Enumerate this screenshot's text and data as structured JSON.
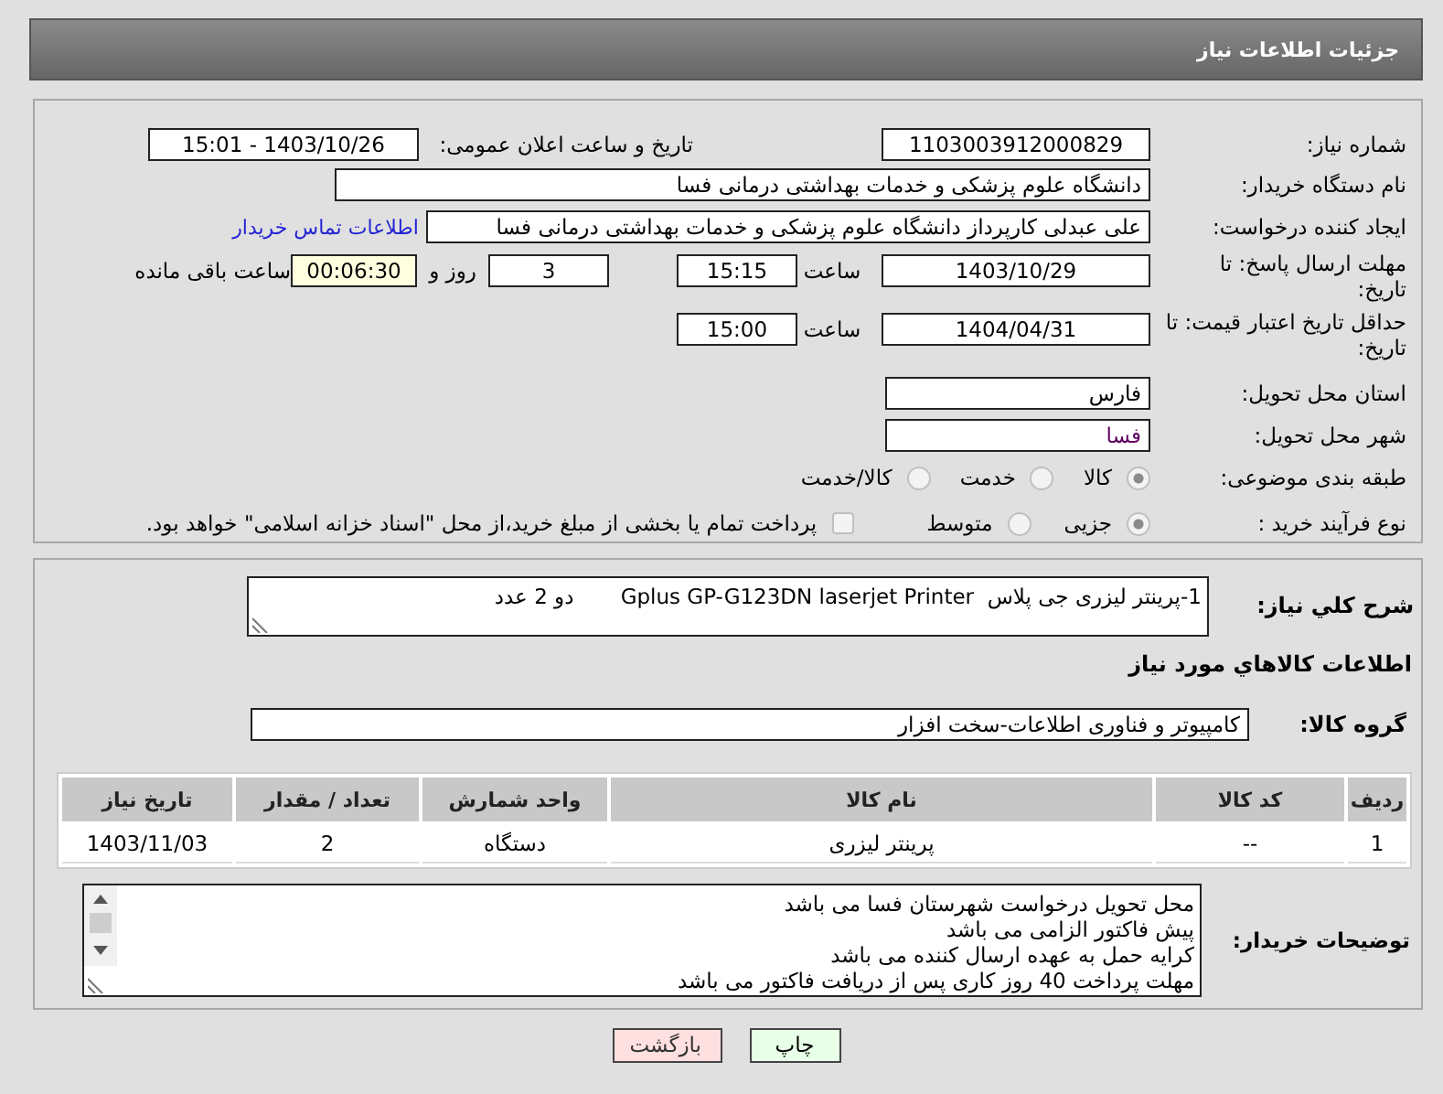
{
  "header": {
    "title": "جزئیات اطلاعات نیاز"
  },
  "details": {
    "need_number": {
      "label": "شماره نیاز:",
      "value": "1103003912000829"
    },
    "announce": {
      "label": "تاریخ و ساعت اعلان عمومی:",
      "value": "1403/10/26 - 15:01"
    },
    "buyer_org": {
      "label": "نام دستگاه خریدار:",
      "value": "دانشگاه علوم پزشکی و خدمات بهداشتی درمانی فسا"
    },
    "requester": {
      "label": "ایجاد کننده درخواست:",
      "value": "علی عبدلی کارپرداز دانشگاه علوم پزشکی و خدمات بهداشتی درمانی فسا",
      "contact_link": "اطلاعات تماس خریدار"
    },
    "reply_deadline": {
      "label": "مهلت ارسال پاسخ: تا تاریخ:",
      "date": "1403/10/29",
      "time_label": "ساعت",
      "time": "15:15",
      "days": "3",
      "days_label": "روز و",
      "remaining": "00:06:30",
      "remaining_label": "ساعت باقی مانده"
    },
    "price_validity": {
      "label": "حداقل تاریخ اعتبار قیمت: تا تاریخ:",
      "date": "1404/04/31",
      "time_label": "ساعت",
      "time": "15:00"
    },
    "province": {
      "label": "استان محل تحویل:",
      "value": "فارس"
    },
    "city": {
      "label": "شهر محل تحویل:",
      "value": "فسا"
    },
    "category": {
      "label": "طبقه بندی موضوعی:",
      "options": [
        {
          "label": "کالا",
          "selected": true
        },
        {
          "label": "خدمت",
          "selected": false
        },
        {
          "label": "کالا/خدمت",
          "selected": false
        }
      ]
    },
    "process": {
      "label": "نوع فرآیند خرید :",
      "options": [
        {
          "label": "جزیی",
          "selected": true
        },
        {
          "label": "متوسط",
          "selected": false
        }
      ],
      "treasury": {
        "checked": false,
        "text": "پرداخت تمام یا بخشی از مبلغ خرید،از محل \"اسناد خزانه اسلامی\" خواهد بود."
      }
    }
  },
  "needs": {
    "summary": {
      "label": "شرح کلي نياز:",
      "value": "1-پرینتر لیزری جی پلاس  Gplus GP-G123DN laserjet Printer       دو 2 عدد"
    },
    "goods_title": "اطلاعات کالاهاي مورد نياز",
    "goods_group": {
      "label": "گروه کالا:",
      "value": "کامپیوتر و فناوری اطلاعات-سخت افزار"
    },
    "table": {
      "columns": [
        "ردیف",
        "کد کالا",
        "نام کالا",
        "واحد شمارش",
        "تعداد / مقدار",
        "تاریخ نیاز"
      ],
      "rows": [
        [
          "1",
          "--",
          "پرینتر لیزری",
          "دستگاه",
          "2",
          "1403/11/03"
        ]
      ]
    },
    "notes": {
      "label": "توضیحات خریدار:",
      "lines": [
        "محل تحویل درخواست شهرستان فسا می باشد",
        "پیش فاکتور الزامی می باشد",
        "کرایه حمل به عهده ارسال کننده می باشد",
        "مهلت پرداخت 40 روز کاری پس از دریافت فاکتور می باشد"
      ]
    }
  },
  "buttons": [
    {
      "kind": "print",
      "label": "چاپ"
    },
    {
      "kind": "back",
      "label": "بازگشت"
    }
  ]
}
